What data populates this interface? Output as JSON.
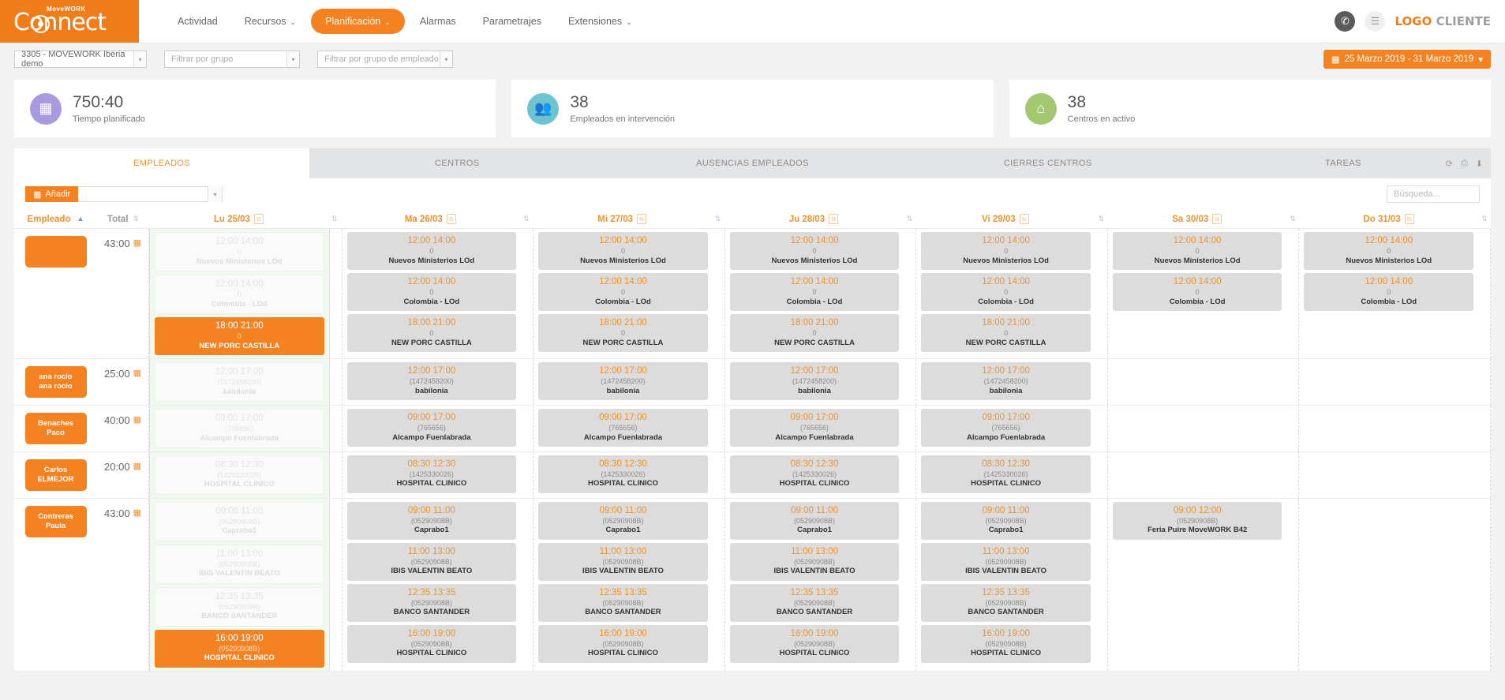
{
  "header": {
    "brand_word": "Connect",
    "brand_sup": "MoveWORK",
    "nav": [
      {
        "label": "Actividad",
        "caret": false,
        "active": false
      },
      {
        "label": "Recursos",
        "caret": true,
        "active": false
      },
      {
        "label": "Planificación",
        "caret": true,
        "active": true
      },
      {
        "label": "Alarmas",
        "caret": false,
        "active": false
      },
      {
        "label": "Parametrajes",
        "caret": false,
        "active": false
      },
      {
        "label": "Extensiones",
        "caret": true,
        "active": false
      }
    ],
    "phone_icon": "phone-icon",
    "menu_icon": "hamburger-icon",
    "logo_part1": "LOGO",
    "logo_part2": "CLIENTE",
    "caret_glyph": "⌄"
  },
  "filters": {
    "company": "3305 - MOVEWORK Iberia demo",
    "group_placeholder": "Filtrar por grupo",
    "employee_group_placeholder": "Filtrar por grupo de empleado",
    "date_range": "25 Marzo 2019 - 31 Marzo 2019",
    "date_caret": "▾",
    "calendar_glyph": "▦"
  },
  "kpis": [
    {
      "value": "750:40",
      "label": "Tiempo planificado",
      "color": "#a99ae0",
      "icon": "calendar-icon",
      "glyph": "▦"
    },
    {
      "value": "38",
      "label": "Empleados en intervención",
      "color": "#6cc4cf",
      "icon": "users-icon",
      "glyph": "👥"
    },
    {
      "value": "38",
      "label": "Centros en activo",
      "color": "#a4c772",
      "icon": "home-icon",
      "glyph": "⌂"
    }
  ],
  "tabs": [
    {
      "label": "EMPLEADOS",
      "active": true
    },
    {
      "label": "CENTROS",
      "active": false
    },
    {
      "label": "AUSENCIAS EMPLEADOS",
      "active": false
    },
    {
      "label": "CIERRES CENTROS",
      "active": false
    },
    {
      "label": "TAREAS",
      "active": false
    }
  ],
  "tab_icons": [
    {
      "name": "refresh-icon",
      "glyph": "⟳"
    },
    {
      "name": "print-icon",
      "glyph": "⎙"
    },
    {
      "name": "download-icon",
      "glyph": "⬇"
    }
  ],
  "toolbar": {
    "add_label": "Añadir",
    "add_glyph": "▦",
    "add_caret": "▾",
    "search_placeholder": "Búsqueda..."
  },
  "grid": {
    "headers": {
      "employee": "Empleado",
      "total": "Total",
      "days": [
        "Lu 25/03",
        "Ma 26/03",
        "Mi 27/03",
        "Ju 28/03",
        "Vi 29/03",
        "Sa 30/03",
        "Do 31/03"
      ]
    },
    "sort_asc_glyph": "▲",
    "sort_both_glyph": "⇅",
    "copy_glyph": "⧉",
    "rows": [
      {
        "employee": [
          "",
          ""
        ],
        "total": "43:00",
        "cells": [
          [
            {
              "time": "12:00 14:00",
              "code": "0",
              "name": "Nuevos Ministerios LOd",
              "style": "ghost"
            },
            {
              "time": "12:00 14:00",
              "code": "0",
              "name": "Colombia - LOd",
              "style": "ghost"
            },
            {
              "time": "18:00 21:00",
              "code": "0",
              "name": "NEW PORC CASTILLA",
              "style": "orange"
            }
          ],
          [
            {
              "time": "12:00 14:00",
              "code": "0",
              "name": "Nuevos Ministerios LOd",
              "style": "grey"
            },
            {
              "time": "12:00 14:00",
              "code": "0",
              "name": "Colombia - LOd",
              "style": "grey"
            },
            {
              "time": "18:00 21:00",
              "code": "0",
              "name": "NEW PORC CASTILLA",
              "style": "grey"
            }
          ],
          [
            {
              "time": "12:00 14:00",
              "code": "0",
              "name": "Nuevos Ministerios LOd",
              "style": "grey"
            },
            {
              "time": "12:00 14:00",
              "code": "0",
              "name": "Colombia - LOd",
              "style": "grey"
            },
            {
              "time": "18:00 21:00",
              "code": "0",
              "name": "NEW PORC CASTILLA",
              "style": "grey"
            }
          ],
          [
            {
              "time": "12:00 14:00",
              "code": "0",
              "name": "Nuevos Ministerios LOd",
              "style": "grey"
            },
            {
              "time": "12:00 14:00",
              "code": "0",
              "name": "Colombia - LOd",
              "style": "grey"
            },
            {
              "time": "18:00 21:00",
              "code": "0",
              "name": "NEW PORC CASTILLA",
              "style": "grey"
            }
          ],
          [
            {
              "time": "12:00 14:00",
              "code": "0",
              "name": "Nuevos Ministerios LOd",
              "style": "grey"
            },
            {
              "time": "12:00 14:00",
              "code": "0",
              "name": "Colombia - LOd",
              "style": "grey"
            },
            {
              "time": "18:00 21:00",
              "code": "0",
              "name": "NEW PORC CASTILLA",
              "style": "grey"
            }
          ],
          [
            {
              "time": "12:00 14:00",
              "code": "0",
              "name": "Nuevos Ministerios LOd",
              "style": "grey"
            },
            {
              "time": "12:00 14:00",
              "code": "0",
              "name": "Colombia - LOd",
              "style": "grey"
            }
          ],
          [
            {
              "time": "12:00 14:00",
              "code": "0",
              "name": "Nuevos Ministerios LOd",
              "style": "grey"
            },
            {
              "time": "12:00 14:00",
              "code": "0",
              "name": "Colombia - LOd",
              "style": "grey"
            }
          ]
        ]
      },
      {
        "employee": [
          "ana rocio",
          "ana rocio"
        ],
        "total": "25:00",
        "cells": [
          [
            {
              "time": "12:00 17:00",
              "code": "(1472458200)",
              "name": "babilonia",
              "style": "ghost"
            }
          ],
          [
            {
              "time": "12:00 17:00",
              "code": "(1472458200)",
              "name": "babilonia",
              "style": "grey"
            }
          ],
          [
            {
              "time": "12:00 17:00",
              "code": "(1472458200)",
              "name": "babilonia",
              "style": "grey"
            }
          ],
          [
            {
              "time": "12:00 17:00",
              "code": "(1472458200)",
              "name": "babilonia",
              "style": "grey"
            }
          ],
          [
            {
              "time": "12:00 17:00",
              "code": "(1472458200)",
              "name": "babilonia",
              "style": "grey"
            }
          ],
          [],
          []
        ]
      },
      {
        "employee": [
          "Benaches",
          "Paco"
        ],
        "total": "40:00",
        "cells": [
          [
            {
              "time": "09:00 17:00",
              "code": "(765656)",
              "name": "Alcampo Fuenlabrada",
              "style": "ghost"
            }
          ],
          [
            {
              "time": "09:00 17:00",
              "code": "(765656)",
              "name": "Alcampo Fuenlabrada",
              "style": "grey"
            }
          ],
          [
            {
              "time": "09:00 17:00",
              "code": "(765656)",
              "name": "Alcampo Fuenlabrada",
              "style": "grey"
            }
          ],
          [
            {
              "time": "09:00 17:00",
              "code": "(765656)",
              "name": "Alcampo Fuenlabrada",
              "style": "grey"
            }
          ],
          [
            {
              "time": "09:00 17:00",
              "code": "(765656)",
              "name": "Alcampo Fuenlabrada",
              "style": "grey"
            }
          ],
          [],
          []
        ]
      },
      {
        "employee": [
          "Carlos",
          "ELMEJOR"
        ],
        "total": "20:00",
        "cells": [
          [
            {
              "time": "08:30 12:30",
              "code": "(1425330026)",
              "name": "HOSPITAL CLINICO",
              "style": "ghost"
            }
          ],
          [
            {
              "time": "08:30 12:30",
              "code": "(1425330026)",
              "name": "HOSPITAL CLINICO",
              "style": "grey"
            }
          ],
          [
            {
              "time": "08:30 12:30",
              "code": "(1425330026)",
              "name": "HOSPITAL CLINICO",
              "style": "grey"
            }
          ],
          [
            {
              "time": "08:30 12:30",
              "code": "(1425330026)",
              "name": "HOSPITAL CLINICO",
              "style": "grey"
            }
          ],
          [
            {
              "time": "08:30 12:30",
              "code": "(1425330026)",
              "name": "HOSPITAL CLINICO",
              "style": "grey"
            }
          ],
          [],
          []
        ]
      },
      {
        "employee": [
          "Contreras",
          "Paula"
        ],
        "total": "43:00",
        "cells": [
          [
            {
              "time": "09:00 11:00",
              "code": "(05290908B)",
              "name": "Caprabo1",
              "style": "ghost"
            },
            {
              "time": "11:00 13:00",
              "code": "(05290908B)",
              "name": "IBIS VALENTIN BEATO",
              "style": "ghost"
            },
            {
              "time": "12:35 13:35",
              "code": "(05290908B)",
              "name": "BANCO SANTANDER",
              "style": "ghost"
            },
            {
              "time": "16:00 19:00",
              "code": "(05290908B)",
              "name": "HOSPITAL CLINICO",
              "style": "orange"
            }
          ],
          [
            {
              "time": "09:00 11:00",
              "code": "(05290908B)",
              "name": "Caprabo1",
              "style": "grey"
            },
            {
              "time": "11:00 13:00",
              "code": "(05290908B)",
              "name": "IBIS VALENTIN BEATO",
              "style": "grey"
            },
            {
              "time": "12:35 13:35",
              "code": "(05290908B)",
              "name": "BANCO SANTANDER",
              "style": "grey"
            },
            {
              "time": "16:00 19:00",
              "code": "(05290908B)",
              "name": "HOSPITAL CLINICO",
              "style": "grey"
            }
          ],
          [
            {
              "time": "09:00 11:00",
              "code": "(05290908B)",
              "name": "Caprabo1",
              "style": "grey"
            },
            {
              "time": "11:00 13:00",
              "code": "(05290908B)",
              "name": "IBIS VALENTIN BEATO",
              "style": "grey"
            },
            {
              "time": "12:35 13:35",
              "code": "(05290908B)",
              "name": "BANCO SANTANDER",
              "style": "grey"
            },
            {
              "time": "16:00 19:00",
              "code": "(05290908B)",
              "name": "HOSPITAL CLINICO",
              "style": "grey"
            }
          ],
          [
            {
              "time": "09:00 11:00",
              "code": "(05290908B)",
              "name": "Caprabo1",
              "style": "grey"
            },
            {
              "time": "11:00 13:00",
              "code": "(05290908B)",
              "name": "IBIS VALENTIN BEATO",
              "style": "grey"
            },
            {
              "time": "12:35 13:35",
              "code": "(05290908B)",
              "name": "BANCO SANTANDER",
              "style": "grey"
            },
            {
              "time": "16:00 19:00",
              "code": "(05290908B)",
              "name": "HOSPITAL CLINICO",
              "style": "grey"
            }
          ],
          [
            {
              "time": "09:00 11:00",
              "code": "(05290908B)",
              "name": "Caprabo1",
              "style": "grey"
            },
            {
              "time": "11:00 13:00",
              "code": "(05290908B)",
              "name": "IBIS VALENTIN BEATO",
              "style": "grey"
            },
            {
              "time": "12:35 13:35",
              "code": "(05290908B)",
              "name": "BANCO SANTANDER",
              "style": "grey"
            },
            {
              "time": "16:00 19:00",
              "code": "(05290908B)",
              "name": "HOSPITAL CLINICO",
              "style": "grey"
            }
          ],
          [
            {
              "time": "09:00 12:00",
              "code": "(05290908B)",
              "name": "Feria Puire MoveWORK B42",
              "style": "grey"
            }
          ],
          []
        ]
      }
    ]
  }
}
